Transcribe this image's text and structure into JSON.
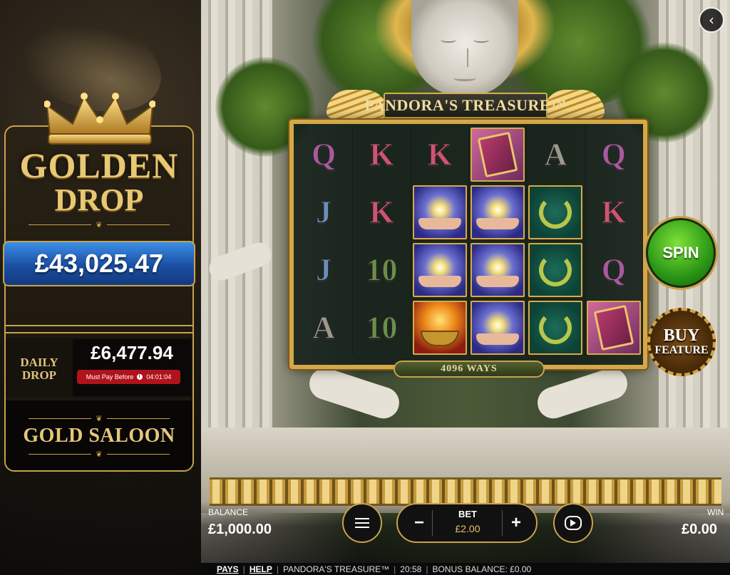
{
  "jackpot": {
    "title_line1": "GOLDEN",
    "title_line2": "DROP",
    "amount": "£43,025.47",
    "daily_label_line1": "DAILY",
    "daily_label_line2": "DROP",
    "daily_amount": "£6,477.94",
    "must_pay_label": "Must Pay Before",
    "must_pay_time": "04:01:04",
    "saloon_label": "GOLD SALOON"
  },
  "game": {
    "title": "PANDORA'S TREASURE™",
    "ways": "4096 WAYS",
    "spin_label": "SPIN",
    "buy_line1": "BUY",
    "buy_line2": "FEATURE",
    "back_icon": "back-arrow-icon",
    "reels": [
      [
        {
          "type": "letter",
          "text": "Q",
          "cls": "c-q"
        },
        {
          "type": "letter",
          "text": "K",
          "cls": "c-k"
        },
        {
          "type": "letter",
          "text": "K",
          "cls": "c-k"
        },
        {
          "type": "book"
        },
        {
          "type": "letter",
          "text": "A",
          "cls": "c-a"
        },
        {
          "type": "letter",
          "text": "Q",
          "cls": "c-q"
        }
      ],
      [
        {
          "type": "letter",
          "text": "J",
          "cls": "c-j"
        },
        {
          "type": "letter",
          "text": "K",
          "cls": "c-k"
        },
        {
          "type": "hands"
        },
        {
          "type": "hands"
        },
        {
          "type": "wreath"
        },
        {
          "type": "letter",
          "text": "K",
          "cls": "c-k"
        }
      ],
      [
        {
          "type": "letter",
          "text": "J",
          "cls": "c-j"
        },
        {
          "type": "letter",
          "text": "10",
          "cls": "c-10"
        },
        {
          "type": "hands"
        },
        {
          "type": "hands"
        },
        {
          "type": "wreath"
        },
        {
          "type": "letter",
          "text": "Q",
          "cls": "c-q"
        }
      ],
      [
        {
          "type": "letter",
          "text": "A",
          "cls": "c-a"
        },
        {
          "type": "letter",
          "text": "10",
          "cls": "c-10"
        },
        {
          "type": "fire"
        },
        {
          "type": "hands"
        },
        {
          "type": "wreath"
        },
        {
          "type": "book"
        }
      ]
    ]
  },
  "controls": {
    "balance_label": "BALANCE",
    "balance_value": "£1,000.00",
    "bet_label": "BET",
    "bet_value": "£2.00",
    "minus": "−",
    "plus": "+",
    "win_label": "WIN",
    "win_value": "£0.00"
  },
  "footer": {
    "pays": "PAYS",
    "help": "HELP",
    "game_name": "PANDORA'S TREASURE™",
    "time": "20:58",
    "bonus_balance": "BONUS BALANCE: £0.00"
  },
  "colors": {
    "gold": "#c9a24b",
    "jackpot_blue": "#1b4fa3",
    "must_pay_red": "#b0131c",
    "spin_green": "#2a9615"
  }
}
